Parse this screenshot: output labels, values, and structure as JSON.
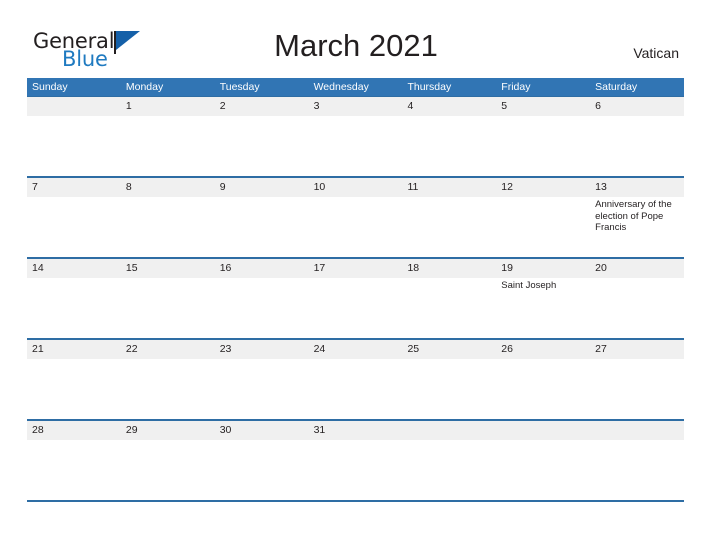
{
  "brand": {
    "name_part1": "General",
    "name_part2": "Blue",
    "color_dark": "#231f20",
    "color_blue": "#1f7ac0",
    "flag_color": "#1560a8"
  },
  "header": {
    "title": "March 2021",
    "country": "Vatican"
  },
  "theme": {
    "header_bar": "#3175b4",
    "date_band": "#f0f0f0",
    "row_rule": "#2e6da4",
    "text": "#231f20"
  },
  "calendar": {
    "weekdays": [
      "Sunday",
      "Monday",
      "Tuesday",
      "Wednesday",
      "Thursday",
      "Friday",
      "Saturday"
    ],
    "weeks": [
      {
        "days": [
          {
            "date": "",
            "event": ""
          },
          {
            "date": "1",
            "event": ""
          },
          {
            "date": "2",
            "event": ""
          },
          {
            "date": "3",
            "event": ""
          },
          {
            "date": "4",
            "event": ""
          },
          {
            "date": "5",
            "event": ""
          },
          {
            "date": "6",
            "event": ""
          }
        ]
      },
      {
        "days": [
          {
            "date": "7",
            "event": ""
          },
          {
            "date": "8",
            "event": ""
          },
          {
            "date": "9",
            "event": ""
          },
          {
            "date": "10",
            "event": ""
          },
          {
            "date": "11",
            "event": ""
          },
          {
            "date": "12",
            "event": ""
          },
          {
            "date": "13",
            "event": "Anniversary of the election of Pope Francis"
          }
        ]
      },
      {
        "days": [
          {
            "date": "14",
            "event": ""
          },
          {
            "date": "15",
            "event": ""
          },
          {
            "date": "16",
            "event": ""
          },
          {
            "date": "17",
            "event": ""
          },
          {
            "date": "18",
            "event": ""
          },
          {
            "date": "19",
            "event": "Saint Joseph"
          },
          {
            "date": "20",
            "event": ""
          }
        ]
      },
      {
        "days": [
          {
            "date": "21",
            "event": ""
          },
          {
            "date": "22",
            "event": ""
          },
          {
            "date": "23",
            "event": ""
          },
          {
            "date": "24",
            "event": ""
          },
          {
            "date": "25",
            "event": ""
          },
          {
            "date": "26",
            "event": ""
          },
          {
            "date": "27",
            "event": ""
          }
        ]
      },
      {
        "days": [
          {
            "date": "28",
            "event": ""
          },
          {
            "date": "29",
            "event": ""
          },
          {
            "date": "30",
            "event": ""
          },
          {
            "date": "31",
            "event": ""
          },
          {
            "date": "",
            "event": ""
          },
          {
            "date": "",
            "event": ""
          },
          {
            "date": "",
            "event": ""
          }
        ]
      }
    ]
  }
}
